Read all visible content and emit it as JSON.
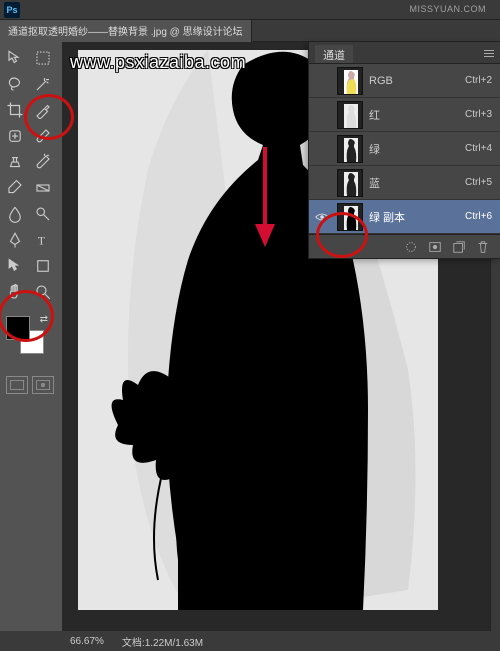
{
  "colors": {
    "annotation": "#c11",
    "foreground": "#000000",
    "background": "#ffffff"
  },
  "menubar": {
    "logo": "Ps"
  },
  "document": {
    "tab_title": "通道抠取透明婚纱——替换背景 .jpg @ 思缘设计论坛"
  },
  "topright_watermark": "MISSYUAN.COM",
  "tools": [
    {
      "name": "move-tool"
    },
    {
      "name": "marquee-tool"
    },
    {
      "name": "lasso-tool"
    },
    {
      "name": "magic-wand-tool"
    },
    {
      "name": "crop-tool"
    },
    {
      "name": "eyedropper-tool"
    },
    {
      "name": "healing-brush-tool"
    },
    {
      "name": "brush-tool"
    },
    {
      "name": "clone-stamp-tool"
    },
    {
      "name": "history-brush-tool"
    },
    {
      "name": "eraser-tool"
    },
    {
      "name": "gradient-tool"
    },
    {
      "name": "blur-tool"
    },
    {
      "name": "dodge-tool"
    },
    {
      "name": "pen-tool"
    },
    {
      "name": "type-tool"
    },
    {
      "name": "path-selection-tool"
    },
    {
      "name": "shape-tool"
    },
    {
      "name": "hand-tool"
    },
    {
      "name": "zoom-tool"
    }
  ],
  "channels_panel": {
    "tab_label": "通道",
    "rows": [
      {
        "name": "RGB",
        "shortcut": "Ctrl+2",
        "visible": false,
        "selected": false,
        "thumb": "rgb"
      },
      {
        "name": "红",
        "shortcut": "Ctrl+3",
        "visible": false,
        "selected": false,
        "thumb": "bw"
      },
      {
        "name": "绿",
        "shortcut": "Ctrl+4",
        "visible": false,
        "selected": false,
        "thumb": "bw"
      },
      {
        "name": "蓝",
        "shortcut": "Ctrl+5",
        "visible": false,
        "selected": false,
        "thumb": "bw"
      },
      {
        "name": "绿 副本",
        "shortcut": "Ctrl+6",
        "visible": true,
        "selected": true,
        "thumb": "bw"
      }
    ]
  },
  "status": {
    "zoom": "66.67%",
    "doc_info": "文档:1.22M/1.63M"
  },
  "watermark": "www.psxiazaiba.com"
}
